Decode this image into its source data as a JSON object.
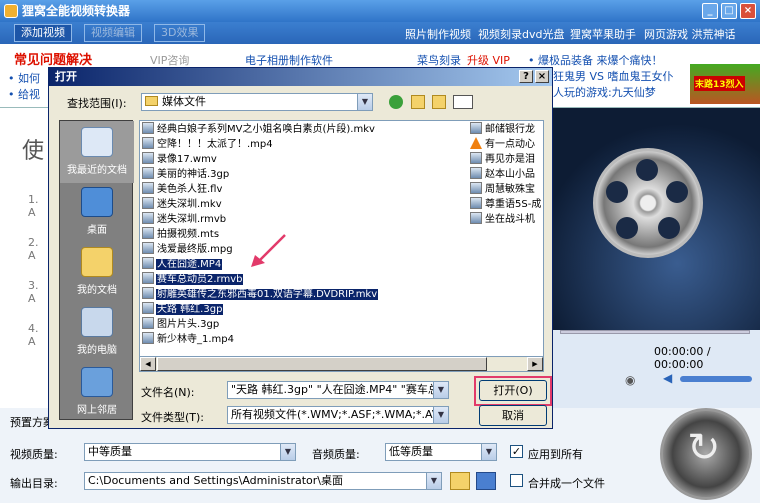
{
  "window": {
    "title": "狸窝全能视频转换器",
    "buttons": [
      "_",
      "□",
      "×"
    ]
  },
  "toolbar": {
    "tabs": [
      {
        "label": "添加视频",
        "active": true
      },
      {
        "label": "视频编辑",
        "active": false
      },
      {
        "label": "3D效果",
        "active": false
      }
    ],
    "links": [
      "照片制作视频",
      "视频刻录dvd光盘",
      "狸窝苹果助手",
      "网页游戏 洪荒神话"
    ]
  },
  "ads": {
    "faq": "常见问题解决",
    "vip": "VIP咨询",
    "line1_left": "• 如何",
    "line2_left": "• 给视",
    "photo_ad": "电子相册制作软件",
    "burn_ad": "菜鸟刻录",
    "upgrade": "升级 VIP",
    "explosion": "• 爆极品装备 来爆个痛快！",
    "game1": "狂鬼男 VS 嗜血鬼王女仆",
    "game2": "人玩的游戏:九天仙梦",
    "game_badge": "末路13烈入"
  },
  "background": {
    "big_char": "使",
    "steps": [
      "1. A",
      "2. A",
      "3. A",
      "4. A"
    ],
    "preset_label": "预置方案",
    "time": "00:00:00 / 00:00:00"
  },
  "settings": {
    "video_quality_label": "视频质量:",
    "video_quality_value": "中等质量",
    "audio_quality_label": "音频质量:",
    "audio_quality_value": "低等质量",
    "apply_all": "应用到所有",
    "apply_all_checked": true,
    "output_label": "输出目录:",
    "output_value": "C:\\Documents and Settings\\Administrator\\桌面",
    "merge": "合并成一个文件",
    "merge_checked": false
  },
  "dialog": {
    "title": "打开",
    "help": "?",
    "close": "×",
    "lookin_label": "查找范围(I):",
    "lookin_value": "媒体文件",
    "places": [
      "我最近的文档",
      "桌面",
      "我的文档",
      "我的电脑",
      "网上邻居"
    ],
    "files_col1": [
      {
        "name": "经典白娘子系列MV之小姐名唤白素贞(片段).mkv",
        "type": "MKV",
        "selected": false
      },
      {
        "name": "空降！！！太派了！.mp4",
        "type": "MP4",
        "selected": false
      },
      {
        "name": "录像17.wmv",
        "type": "WMV",
        "selected": false
      },
      {
        "name": "美丽的神话.3gp",
        "type": "3GP",
        "selected": false
      },
      {
        "name": "美色杀人狂.flv",
        "type": "FLV",
        "selected": false
      },
      {
        "name": "迷失深圳.mkv",
        "type": "MKV",
        "selected": false
      },
      {
        "name": "迷失深圳.rmvb",
        "type": "RMVB",
        "selected": false
      },
      {
        "name": "拍摄视频.mts",
        "type": "MTS",
        "selected": false
      },
      {
        "name": "浅爱最终版.mpg",
        "type": "MPG",
        "selected": false
      },
      {
        "name": "人在囧途.MP4",
        "type": "MP4",
        "selected": true
      },
      {
        "name": "赛车总动员2.rmvb",
        "type": "RMVB",
        "selected": true
      },
      {
        "name": "射雕英雄传之东邪西毒01.双语字幕.DVDRIP.mkv",
        "type": "MKV",
        "selected": true
      },
      {
        "name": "天路 韩红.3gp",
        "type": "3GP",
        "selected": true
      },
      {
        "name": "图片片头.3gp",
        "type": "3GP",
        "selected": false
      },
      {
        "name": "新少林寺_1.mp4",
        "type": "MP4",
        "selected": false
      }
    ],
    "files_col2": [
      {
        "name": "邮储银行龙",
        "type": "MP4"
      },
      {
        "name": "有一点动心",
        "type": "VLC"
      },
      {
        "name": "再见亦是泪",
        "type": "MP4"
      },
      {
        "name": "赵本山小品",
        "type": "MP4"
      },
      {
        "name": "周慧敏殊宝",
        "type": "MP4"
      },
      {
        "name": "尊重语5S-成",
        "type": "MP4"
      },
      {
        "name": "坐在战斗机",
        "type": "MP4"
      }
    ],
    "filename_label": "文件名(N):",
    "filename_value": "\"天路 韩红.3gp\" \"人在囧途.MP4\" \"赛车总",
    "filetype_label": "文件类型(T):",
    "filetype_value": "所有视频文件(*.WMV;*.ASF;*.WMA;*.AVI;",
    "open_button": "打开(O)",
    "cancel_button": "取消"
  },
  "colors": {
    "selection": "#0a246a",
    "highlight_box": "#e23a6a",
    "titlebar": "#2f74c8"
  }
}
